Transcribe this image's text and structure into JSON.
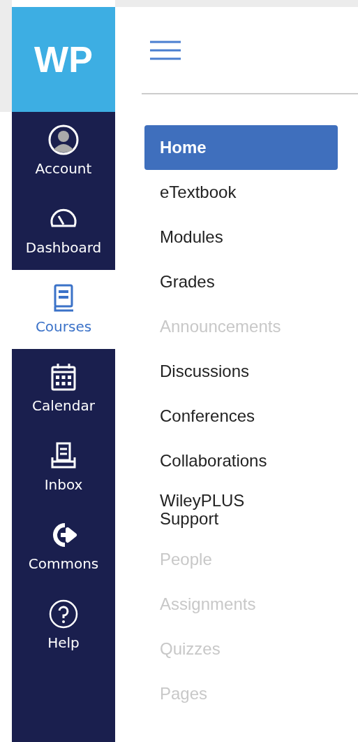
{
  "logo": "WP",
  "global_nav": [
    {
      "label": "Account",
      "kind": "account",
      "selected": false
    },
    {
      "label": "Dashboard",
      "kind": "dashboard",
      "selected": false
    },
    {
      "label": "Courses",
      "kind": "courses",
      "selected": true
    },
    {
      "label": "Calendar",
      "kind": "calendar",
      "selected": false
    },
    {
      "label": "Inbox",
      "kind": "inbox",
      "selected": false
    },
    {
      "label": "Commons",
      "kind": "commons",
      "selected": false
    },
    {
      "label": "Help",
      "kind": "help",
      "selected": false
    }
  ],
  "course_nav": [
    {
      "label": "Home",
      "selected": true,
      "disabled": false
    },
    {
      "label": "eTextbook",
      "selected": false,
      "disabled": false
    },
    {
      "label": "Modules",
      "selected": false,
      "disabled": false
    },
    {
      "label": "Grades",
      "selected": false,
      "disabled": false
    },
    {
      "label": "Announcements",
      "selected": false,
      "disabled": true
    },
    {
      "label": "Discussions",
      "selected": false,
      "disabled": false
    },
    {
      "label": "Conferences",
      "selected": false,
      "disabled": false
    },
    {
      "label": "Collaborations",
      "selected": false,
      "disabled": false
    },
    {
      "label": "WileyPLUS Support",
      "selected": false,
      "disabled": false
    },
    {
      "label": "People",
      "selected": false,
      "disabled": true
    },
    {
      "label": "Assignments",
      "selected": false,
      "disabled": true
    },
    {
      "label": "Quizzes",
      "selected": false,
      "disabled": true
    },
    {
      "label": "Pages",
      "selected": false,
      "disabled": true
    }
  ]
}
